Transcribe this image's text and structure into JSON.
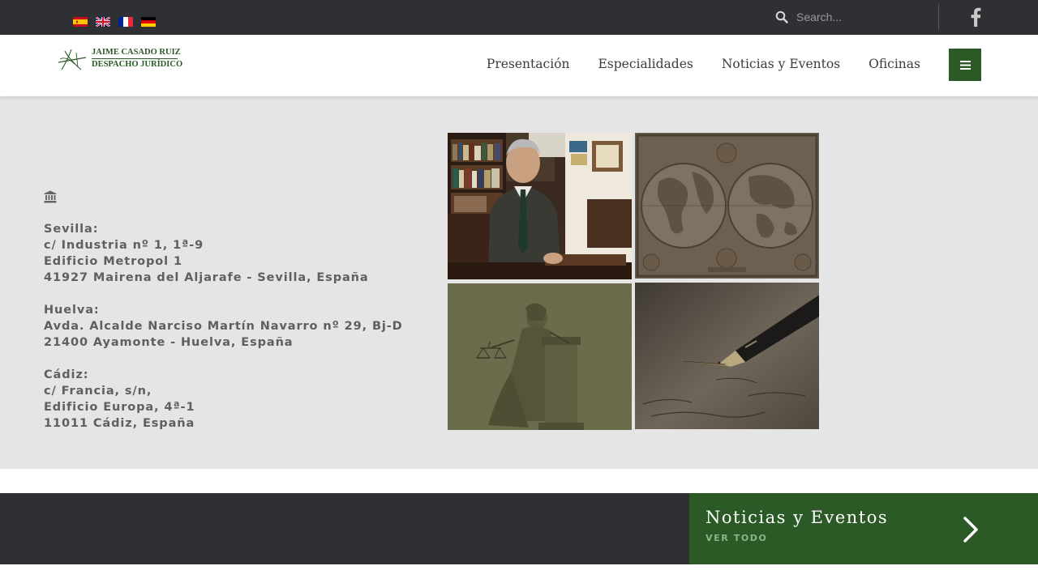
{
  "topbar": {
    "languages": [
      {
        "code": "es",
        "label": "Español"
      },
      {
        "code": "en",
        "label": "English"
      },
      {
        "code": "fr",
        "label": "Français"
      },
      {
        "code": "de",
        "label": "Deutsch"
      }
    ],
    "search": {
      "placeholder": "Search...",
      "value": ""
    },
    "social_icon": "facebook-icon"
  },
  "header": {
    "logo": {
      "line1": "JAIME CASADO RUIZ",
      "line2": "DESPACHO JURÍDICO"
    },
    "nav": [
      {
        "label": "Presentación"
      },
      {
        "label": "Especialidades"
      },
      {
        "label": "Noticias y Eventos"
      },
      {
        "label": "Oficinas"
      }
    ],
    "menu_icon": "hamburger-icon"
  },
  "offices_section": {
    "icon": "bank-icon",
    "offices": [
      {
        "city": "Sevilla:",
        "lines": [
          "c/ Industria nº 1, 1ª-9",
          "Edificio Metropol 1",
          "41927 Mairena del Aljarafe - Sevilla, España"
        ]
      },
      {
        "city": "Huelva:",
        "lines": [
          "Avda. Alcalde Narciso Martín Navarro nº 29, Bj-D",
          "21400 Ayamonte - Huelva, España"
        ]
      },
      {
        "city": "Cádiz:",
        "lines": [
          "c/ Francia, s/n,",
          "Edificio Europa, 4ª-1",
          "11011 Cádiz, España"
        ]
      }
    ]
  },
  "gallery": [
    {
      "subject": "lawyer-in-office-photo"
    },
    {
      "subject": "antique-world-map"
    },
    {
      "subject": "lady-justice-statue"
    },
    {
      "subject": "fountain-pen-writing"
    }
  ],
  "news_banner": {
    "title": "Noticias y Eventos",
    "subtitle": "VER TODO",
    "icon": "chevron-right-icon"
  },
  "colors": {
    "brand_green": "#2b5a26",
    "dark_bar": "#2f3033",
    "section_gray": "#e5e5e5"
  }
}
